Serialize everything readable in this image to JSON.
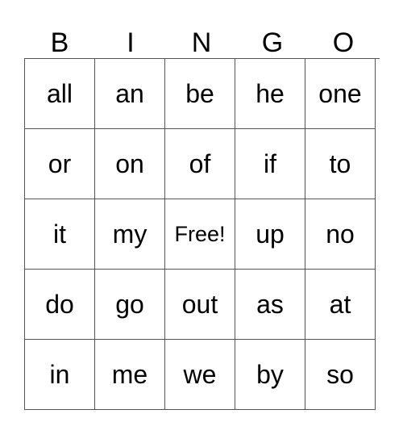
{
  "card": {
    "header": {
      "letters": [
        "B",
        "I",
        "N",
        "G",
        "O"
      ]
    },
    "grid": {
      "columns": 5,
      "rows": 5,
      "free_space_label": "Free!",
      "border_color": "#555555",
      "text_color": "#000000",
      "background_color": "#ffffff",
      "cells": [
        [
          "all",
          "an",
          "be",
          "he",
          "one"
        ],
        [
          "or",
          "on",
          "of",
          "if",
          "to"
        ],
        [
          "it",
          "my",
          "Free!",
          "up",
          "no"
        ],
        [
          "do",
          "go",
          "out",
          "as",
          "at"
        ],
        [
          "in",
          "me",
          "we",
          "by",
          "so"
        ]
      ]
    }
  }
}
